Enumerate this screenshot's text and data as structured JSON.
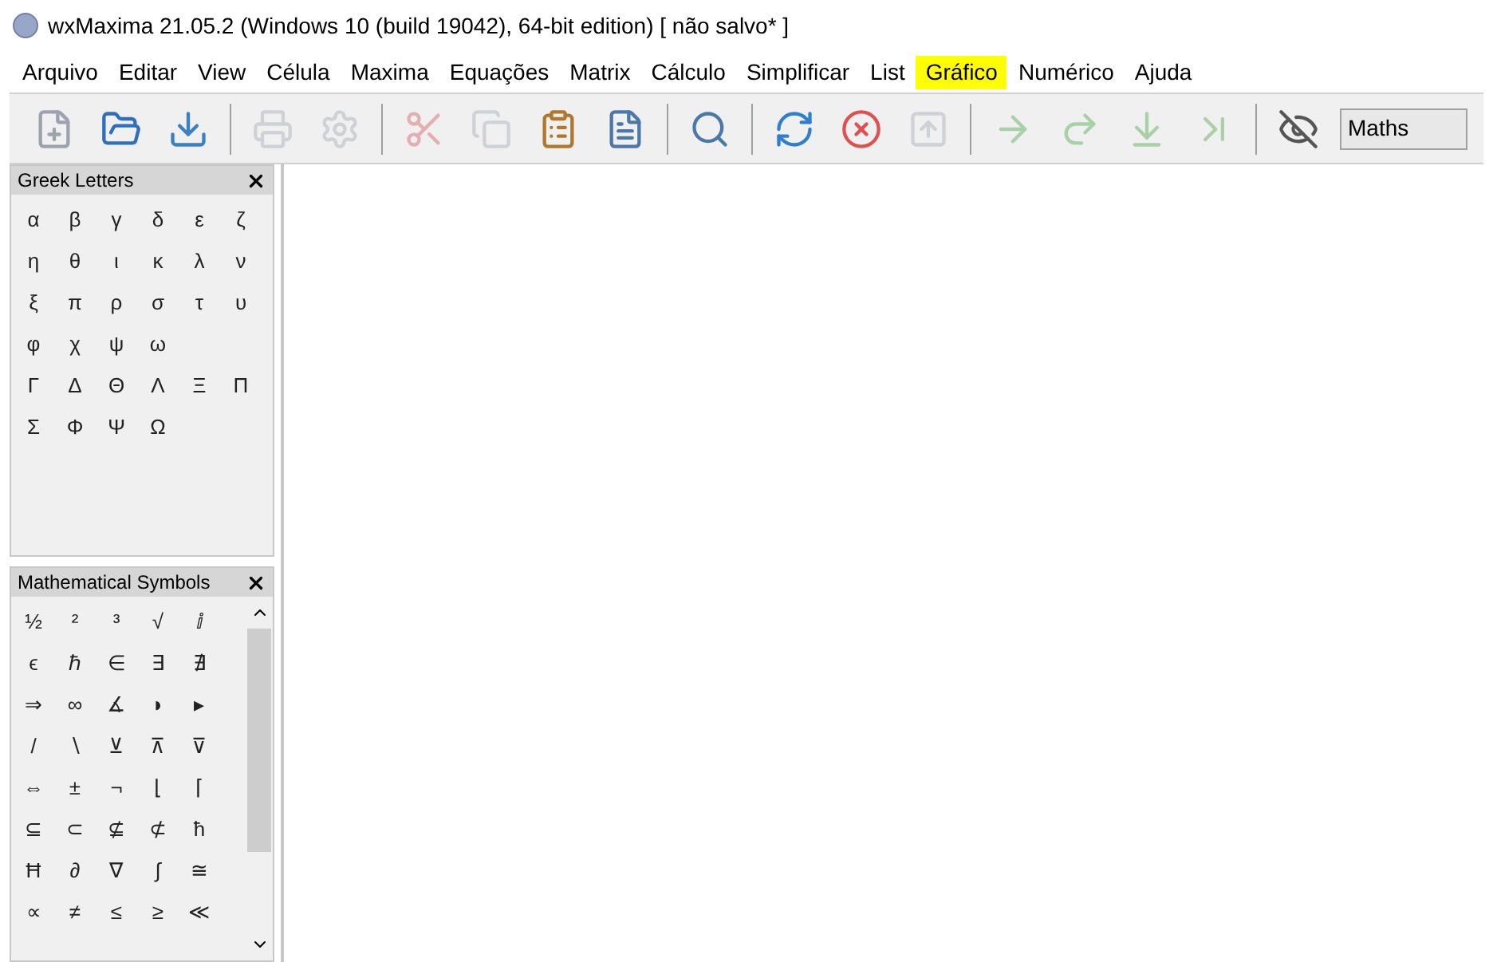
{
  "window": {
    "title": "wxMaxima 21.05.2 (Windows 10 (build 19042), 64-bit edition) [ não salvo* ]"
  },
  "menu": [
    {
      "label": "Arquivo",
      "highlighted": false
    },
    {
      "label": "Editar",
      "highlighted": false
    },
    {
      "label": "View",
      "highlighted": false
    },
    {
      "label": "Célula",
      "highlighted": false
    },
    {
      "label": "Maxima",
      "highlighted": false
    },
    {
      "label": "Equações",
      "highlighted": false
    },
    {
      "label": "Matrix",
      "highlighted": false
    },
    {
      "label": "Cálculo",
      "highlighted": false
    },
    {
      "label": "Simplificar",
      "highlighted": false
    },
    {
      "label": "List",
      "highlighted": false
    },
    {
      "label": "Gráfico",
      "highlighted": true
    },
    {
      "label": "Numérico",
      "highlighted": false
    },
    {
      "label": "Ajuda",
      "highlighted": false
    }
  ],
  "toolbar": {
    "groups": [
      [
        {
          "kind": "new",
          "disabled": false
        },
        {
          "kind": "open",
          "disabled": false
        },
        {
          "kind": "save",
          "disabled": false
        }
      ],
      [
        {
          "kind": "print",
          "disabled": true
        },
        {
          "kind": "settings",
          "disabled": true
        }
      ],
      [
        {
          "kind": "cut",
          "disabled": true
        },
        {
          "kind": "copy",
          "disabled": true
        },
        {
          "kind": "paste",
          "disabled": false
        },
        {
          "kind": "select",
          "disabled": false
        }
      ],
      [
        {
          "kind": "find",
          "disabled": false
        }
      ],
      [
        {
          "kind": "refresh",
          "disabled": false
        },
        {
          "kind": "stop",
          "disabled": false
        },
        {
          "kind": "up",
          "disabled": true
        }
      ],
      [
        {
          "kind": "next",
          "disabled": true
        },
        {
          "kind": "redo",
          "disabled": true
        },
        {
          "kind": "down",
          "disabled": true
        },
        {
          "kind": "last",
          "disabled": true
        }
      ],
      [
        {
          "kind": "hide",
          "disabled": false
        }
      ]
    ],
    "style_select": {
      "value": "Maths"
    }
  },
  "greek_panel": {
    "title": "Greek Letters",
    "rows": [
      [
        "α",
        "β",
        "γ",
        "δ",
        "ε",
        "ζ"
      ],
      [
        "η",
        "θ",
        "ι",
        "κ",
        "λ",
        "ν"
      ],
      [
        "ξ",
        "π",
        "ρ",
        "σ",
        "τ",
        "υ"
      ],
      [
        "φ",
        "χ",
        "ψ",
        "ω"
      ],
      [
        "Γ",
        "Δ",
        "Θ",
        "Λ",
        "Ξ",
        "Π"
      ],
      [
        "Σ",
        "Φ",
        "Ψ",
        "Ω"
      ]
    ]
  },
  "symbols_panel": {
    "title": "Mathematical Symbols",
    "rows": [
      [
        "½",
        "²",
        "³",
        "√",
        "ⅈ"
      ],
      [
        "ϵ",
        "ℏ",
        "∈",
        "∃",
        "∄"
      ],
      [
        "⇒",
        "∞",
        "∡",
        "◗",
        "▸"
      ],
      [
        "/",
        "∖",
        "⊻",
        "⊼",
        "⊽"
      ],
      [
        "⇔",
        "±",
        "¬",
        "⌊",
        "⌈"
      ],
      [
        "⊆",
        "⊂",
        "⊈",
        "⊄",
        "ħ"
      ],
      [
        "Ħ",
        "∂",
        "∇",
        "∫",
        "≅"
      ],
      [
        "∝",
        "≠",
        "≤",
        "≥",
        "≪"
      ]
    ]
  }
}
